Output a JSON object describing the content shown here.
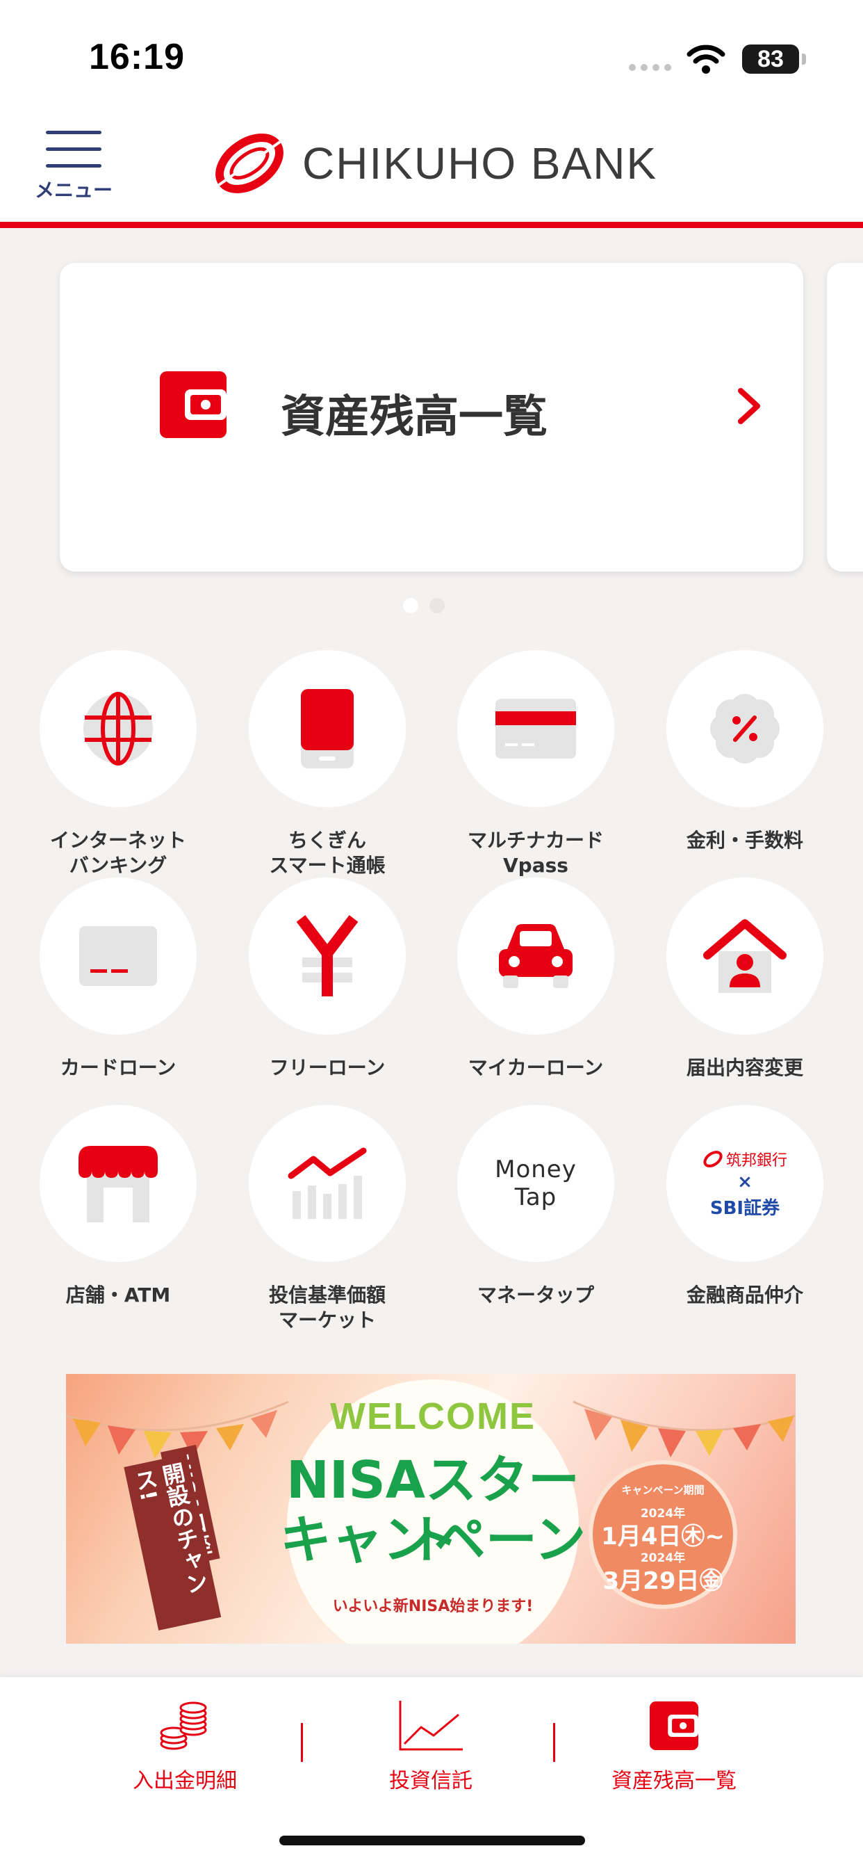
{
  "status_bar": {
    "time": "16:19",
    "battery": "83"
  },
  "header": {
    "menu_label": "メニュー",
    "brand_name": "CHIKUHO BANK"
  },
  "carousel": {
    "card_title": "資産残高一覧",
    "page_count": 2,
    "active_page": 1
  },
  "grid": [
    {
      "label": "インターネット\nバンキング",
      "icon": "globe-icon"
    },
    {
      "label": "ちくぎん\nスマート通帳",
      "icon": "smartphone-passbook-icon"
    },
    {
      "label": "マルチナカード\nVpass",
      "icon": "credit-card-icon"
    },
    {
      "label": "金利・手数料",
      "icon": "percent-badge-icon"
    },
    {
      "label": "カードローン",
      "icon": "loan-card-icon"
    },
    {
      "label": "フリーローン",
      "icon": "yen-icon"
    },
    {
      "label": "マイカーローン",
      "icon": "car-icon"
    },
    {
      "label": "届出内容変更",
      "icon": "house-person-icon"
    },
    {
      "label": "店舗・ATM",
      "icon": "store-icon"
    },
    {
      "label": "投信基準価額\nマーケット",
      "icon": "chart-trend-icon"
    },
    {
      "label": "マネータップ",
      "icon": "money-tap-logo-icon",
      "logo_text": "Money\nTap"
    },
    {
      "label": "金融商品仲介",
      "icon": "sbi-partnership-logo-icon",
      "logo_line1": "筑邦銀行",
      "logo_x": "×",
      "logo_line2": "SBI証券"
    }
  ],
  "banner": {
    "welcome": "WELCOME",
    "title_line1": "NISAスタート",
    "title_line2": "キャンペーン",
    "subtitle": "いよいよ新NISA始まります!",
    "vertical_col1": "NISA口座",
    "vertical_col2": "開設のチャンス!",
    "badge_label": "キャンペーン期間",
    "badge_year1": "2024年",
    "badge_date1": "1月4日㊍~",
    "badge_year2": "2024年",
    "badge_date2": "3月29日㊎"
  },
  "tab_bar": {
    "items": [
      {
        "label": "入出金明細",
        "icon": "coins-icon"
      },
      {
        "label": "投資信託",
        "icon": "line-chart-icon"
      },
      {
        "label": "資産残高一覧",
        "icon": "wallet-icon"
      }
    ]
  },
  "colors": {
    "brand_red": "#e60012",
    "menu_navy": "#2f3d78",
    "background": "#f3f2f1",
    "nisa_green": "#1aa14b"
  }
}
